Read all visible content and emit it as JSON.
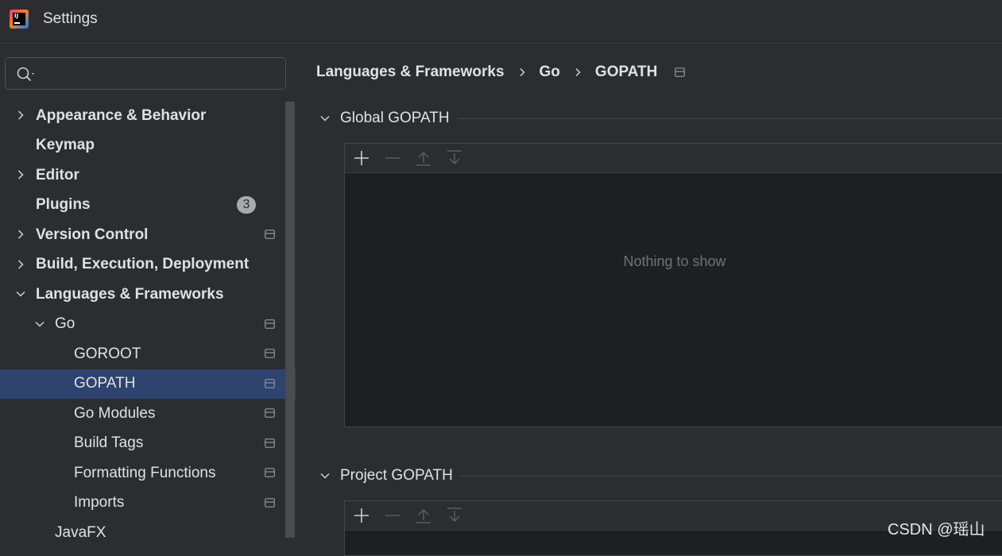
{
  "window": {
    "title": "Settings"
  },
  "search": {
    "placeholder": ""
  },
  "tree": [
    {
      "label": "Appearance & Behavior",
      "bold": true,
      "chevron": "right",
      "level": 0
    },
    {
      "label": "Keymap",
      "bold": true,
      "chevron": "none",
      "level": 0
    },
    {
      "label": "Editor",
      "bold": true,
      "chevron": "right",
      "level": 0
    },
    {
      "label": "Plugins",
      "bold": true,
      "chevron": "none",
      "level": 0,
      "badge": "3"
    },
    {
      "label": "Version Control",
      "bold": true,
      "chevron": "right",
      "level": 0,
      "project_icon": true
    },
    {
      "label": "Build, Execution, Deployment",
      "bold": true,
      "chevron": "right",
      "level": 0
    },
    {
      "label": "Languages & Frameworks",
      "bold": true,
      "chevron": "down",
      "level": 0
    },
    {
      "label": "Go",
      "bold": false,
      "chevron": "down",
      "level": 1,
      "project_icon": true
    },
    {
      "label": "GOROOT",
      "bold": false,
      "chevron": "none",
      "level": 2,
      "project_icon": true
    },
    {
      "label": "GOPATH",
      "bold": false,
      "chevron": "none",
      "level": 2,
      "project_icon": true,
      "selected": true
    },
    {
      "label": "Go Modules",
      "bold": false,
      "chevron": "none",
      "level": 2,
      "project_icon": true
    },
    {
      "label": "Build Tags",
      "bold": false,
      "chevron": "none",
      "level": 2,
      "project_icon": true
    },
    {
      "label": "Formatting Functions",
      "bold": false,
      "chevron": "none",
      "level": 2,
      "project_icon": true
    },
    {
      "label": "Imports",
      "bold": false,
      "chevron": "none",
      "level": 2,
      "project_icon": true
    },
    {
      "label": "JavaFX",
      "bold": false,
      "chevron": "none",
      "level": 1
    }
  ],
  "breadcrumb": [
    "Languages & Frameworks",
    "Go",
    "GOPATH"
  ],
  "sections": {
    "global": {
      "title": "Global GOPATH",
      "empty_text": "Nothing to show"
    },
    "project": {
      "title": "Project GOPATH"
    }
  },
  "watermark": "CSDN @瑶山",
  "colors": {
    "selection": "#2e436e",
    "background": "#2b2d30",
    "panel": "#1e1f22"
  },
  "icons": {
    "search": "search-icon",
    "add": "plus-icon",
    "remove": "minus-icon",
    "up": "move-up-icon",
    "down": "move-down-icon",
    "project": "project-level-icon"
  }
}
